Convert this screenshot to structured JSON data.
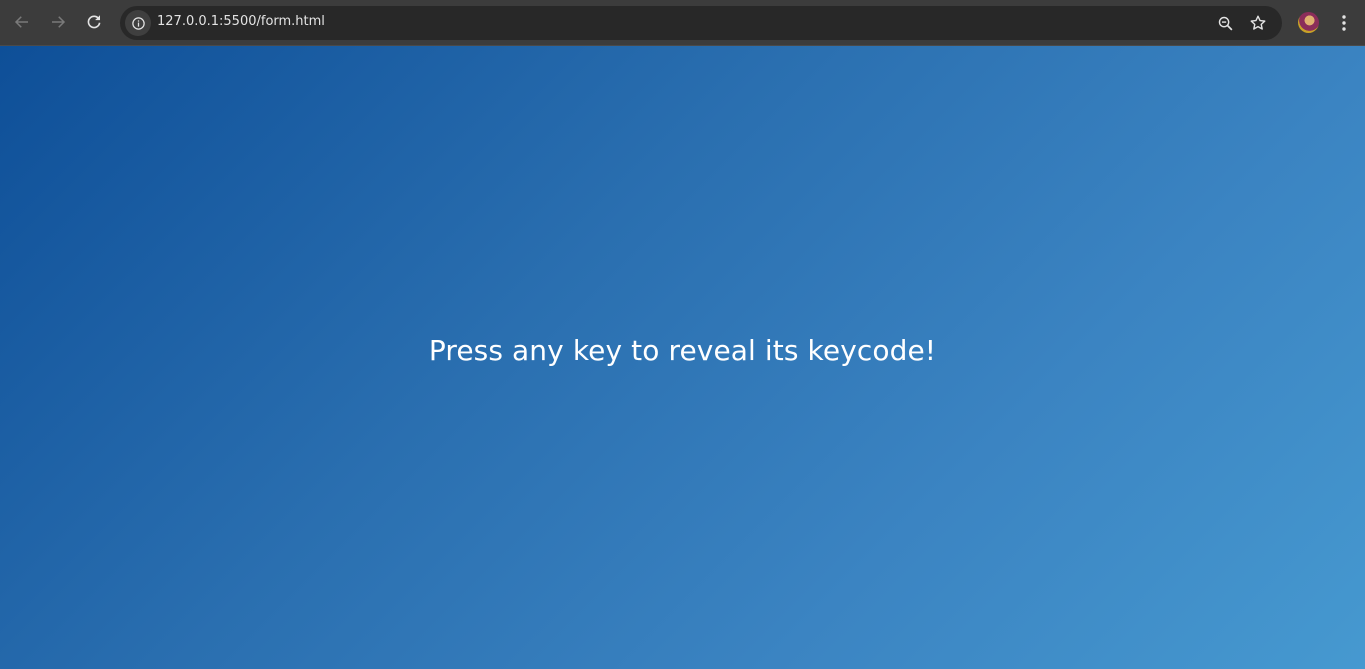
{
  "browser": {
    "url": "127.0.0.1:5500/form.html",
    "icons": {
      "back": "arrow-left-icon",
      "forward": "arrow-right-icon",
      "reload": "reload-icon",
      "site_info": "info-icon",
      "zoom": "zoom-out-icon",
      "bookmark": "star-icon",
      "menu": "kebab-menu-icon"
    }
  },
  "page": {
    "message": "Press any key to reveal its keycode!"
  },
  "colors": {
    "toolbar": "#3c3c3c",
    "omnibox": "#282828",
    "gradient_start": "#0e4f98",
    "gradient_end": "#4699d0",
    "text": "#ffffff"
  }
}
